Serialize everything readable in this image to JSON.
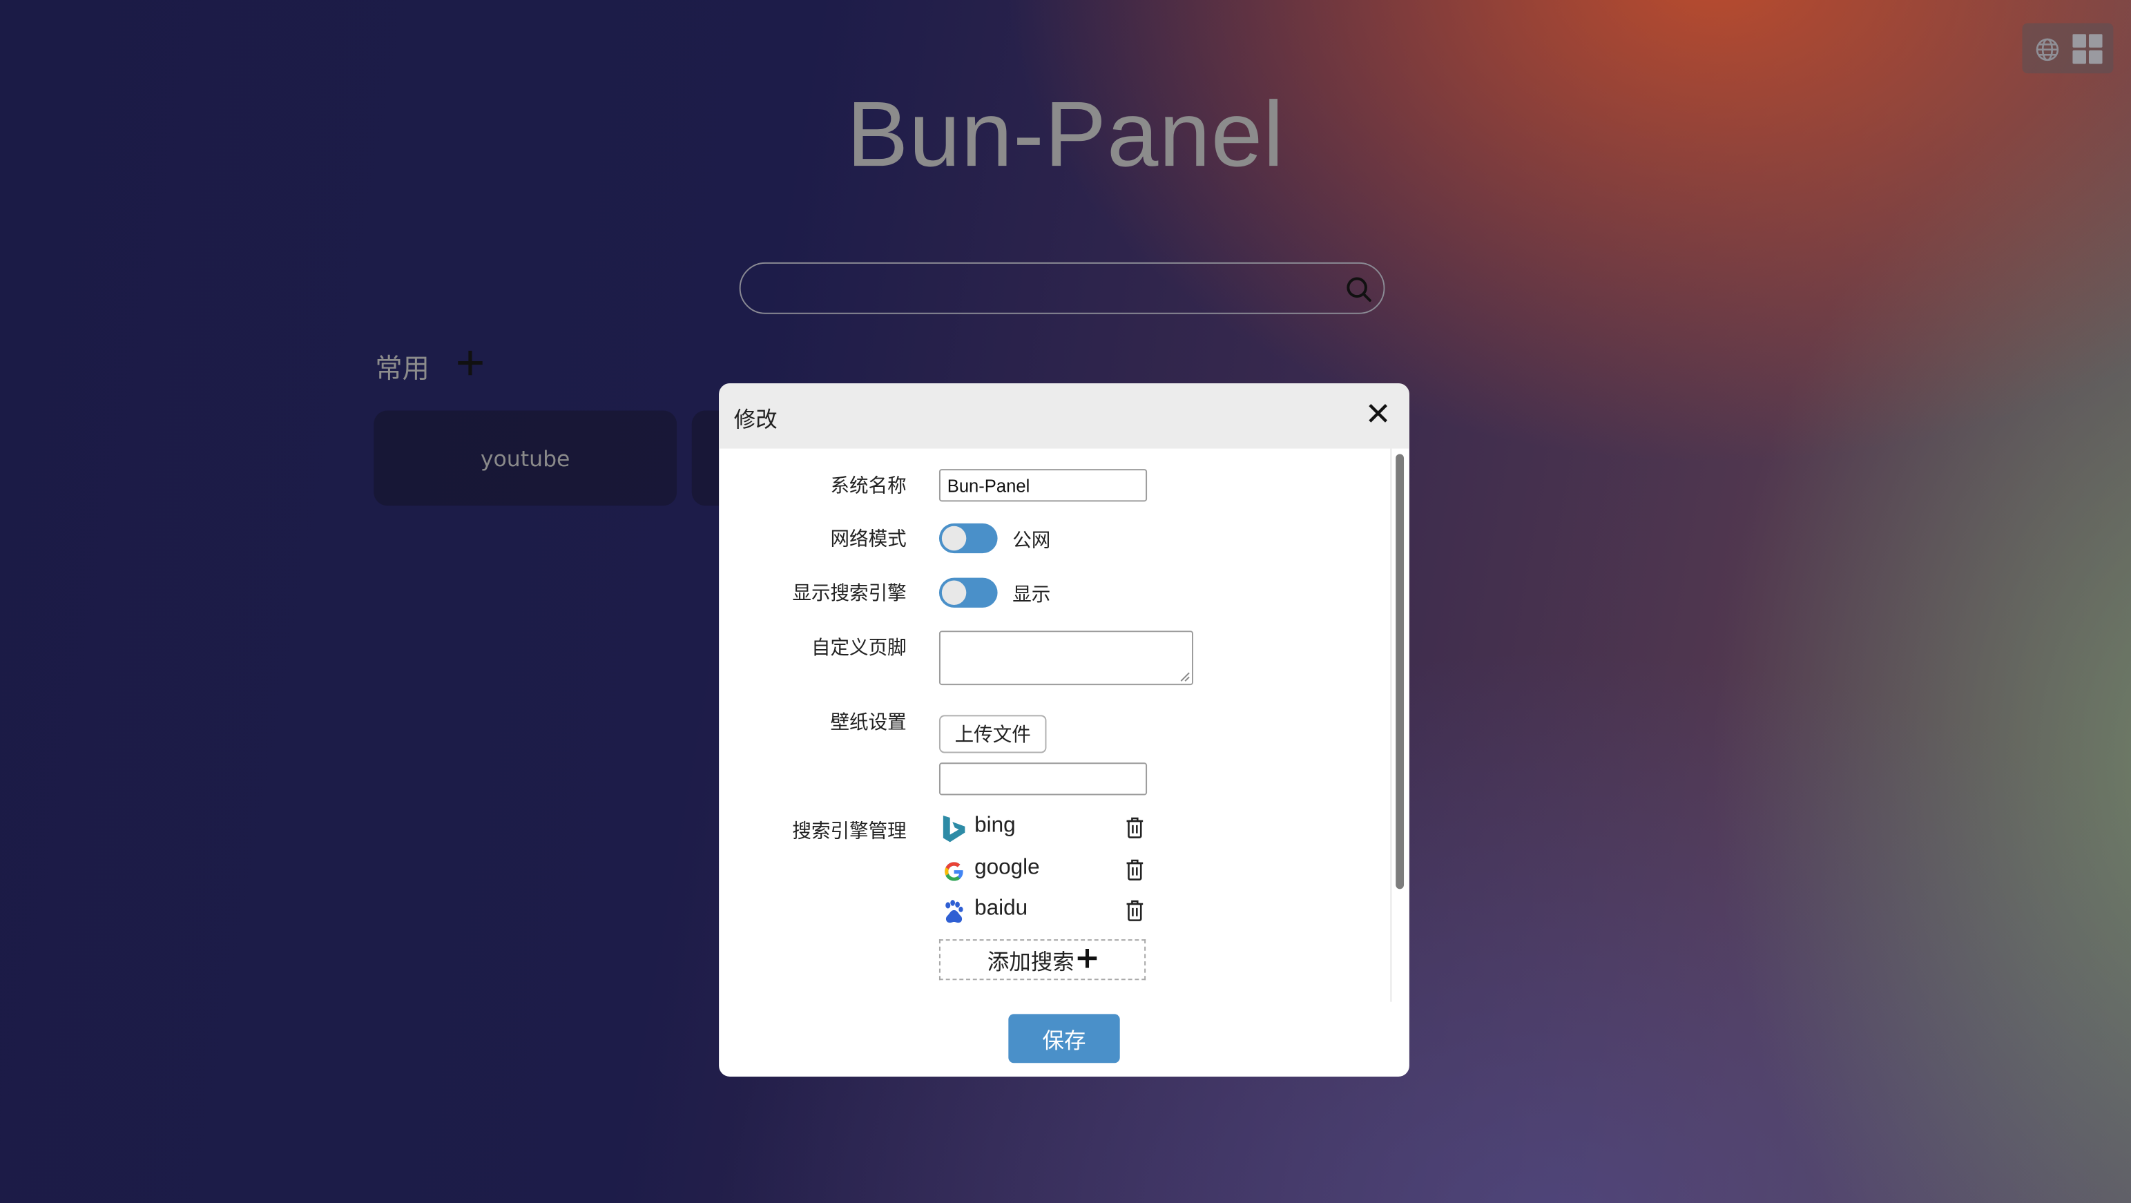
{
  "app": {
    "title": "Bun-Panel"
  },
  "topbar": {
    "network_icon": "globe-icon",
    "layout_icon": "grid-icon"
  },
  "search": {
    "placeholder": "",
    "value": "",
    "icon": "search-icon"
  },
  "group": {
    "label": "常用",
    "add_icon": "plus-icon"
  },
  "cards": [
    {
      "label": "youtube"
    },
    {
      "label": ""
    }
  ],
  "modal": {
    "title": "修改",
    "close_icon": "close-icon",
    "fields": {
      "system_name": {
        "label": "系统名称",
        "value": "Bun-Panel"
      },
      "network_mode": {
        "label": "网络模式",
        "state_text": "公网"
      },
      "show_search": {
        "label": "显示搜索引擎",
        "state_text": "显示"
      },
      "custom_footer": {
        "label": "自定义页脚",
        "value": ""
      },
      "wallpaper": {
        "label": "壁纸设置",
        "upload_label": "上传文件",
        "value": ""
      },
      "search_engines": {
        "label": "搜索引擎管理",
        "items": [
          {
            "name": "bing",
            "icon": "bing-icon"
          },
          {
            "name": "google",
            "icon": "google-icon"
          },
          {
            "name": "baidu",
            "icon": "baidu-icon"
          }
        ],
        "add_label": "添加搜索",
        "add_icon": "plus-icon",
        "delete_icon": "trash-icon"
      }
    },
    "save_label": "保存"
  },
  "colors": {
    "accent": "#4a90c9",
    "title_gray": "#8c8c8c",
    "modal_header": "#ececec"
  }
}
